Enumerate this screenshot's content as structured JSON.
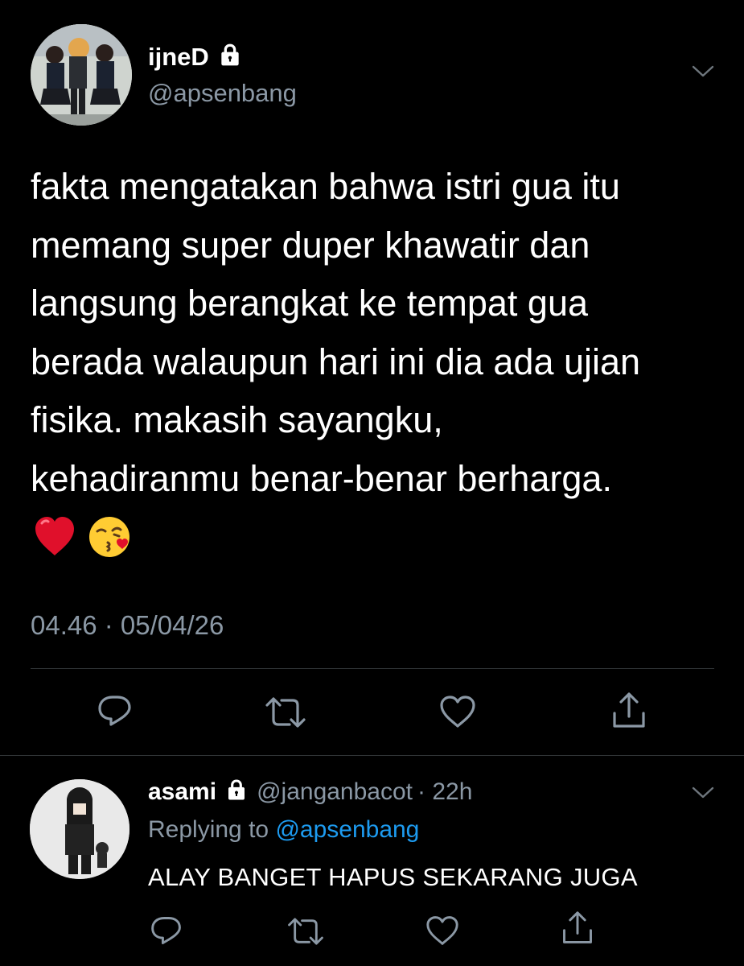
{
  "tweet": {
    "display_name": "ijneD",
    "handle": "@apsenbang",
    "text": "fakta mengatakan bahwa istri gua itu\nmemang super duper khawatir dan\nlangsung berangkat ke tempat gua\nberada walaupun hari ini dia ada ujian\nfisika. makasih sayangku,\nkehadiranmu benar-benar berharga.",
    "emojis": [
      "red-heart-emoji",
      "face-blowing-kiss-emoji"
    ],
    "timestamp": "04.46 · 05/04/26",
    "actions": [
      "reply-icon",
      "retweet-icon",
      "like-icon",
      "share-icon"
    ]
  },
  "reply": {
    "display_name": "asami",
    "handle": "@janganbacot",
    "time": "· 22h",
    "replying_to_label": "Replying to",
    "replying_to_mention": "@apsenbang",
    "text": "ALAY BANGET HAPUS SEKARANG JUGA",
    "actions": [
      "reply-icon",
      "retweet-icon",
      "like-icon",
      "share-icon"
    ]
  },
  "colors": {
    "background": "#000000",
    "text_primary": "#ffffff",
    "text_secondary": "#8b98a5",
    "link": "#1d9bf0",
    "divider": "#2f3336",
    "heart": "#e0102b",
    "emoji_face": "#ffcc33"
  }
}
